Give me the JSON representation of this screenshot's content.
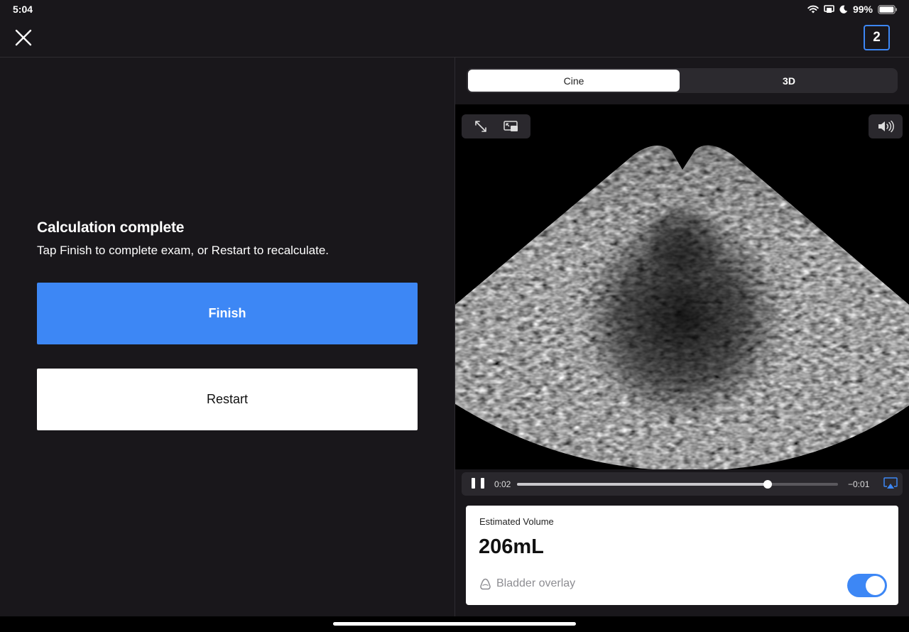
{
  "status_bar": {
    "time": "5:04",
    "battery_percent": "99%",
    "battery_level": 0.99,
    "icons": [
      "wifi-icon",
      "screen-mirroring-icon",
      "moon-icon",
      "battery-icon"
    ]
  },
  "header": {
    "close_icon": "close-icon",
    "exam_count": "2"
  },
  "calculation": {
    "title": "Calculation complete",
    "subtitle": "Tap Finish to complete exam, or Restart to recalculate.",
    "finish_label": "Finish",
    "restart_label": "Restart"
  },
  "viewer_tabs": [
    {
      "label": "Cine",
      "selected": true
    },
    {
      "label": "3D",
      "selected": false
    }
  ],
  "viewer_tools": {
    "expand_icon": "expand-icon",
    "picture_in_picture_icon": "picture-in-picture-icon",
    "sound_icon": "speaker-icon"
  },
  "player": {
    "elapsed": "0:02",
    "remaining": "−0:01",
    "progress": 0.78,
    "state": "playing",
    "airplay_icon": "airplay-icon"
  },
  "volume": {
    "label": "Estimated Volume",
    "value": "206mL",
    "overlay_label": "Bladder overlay",
    "overlay_icon": "bladder-icon",
    "overlay_enabled": true
  },
  "colors": {
    "accent": "#3d87f5",
    "background": "#19171b",
    "panel_control": "#2a282d"
  }
}
